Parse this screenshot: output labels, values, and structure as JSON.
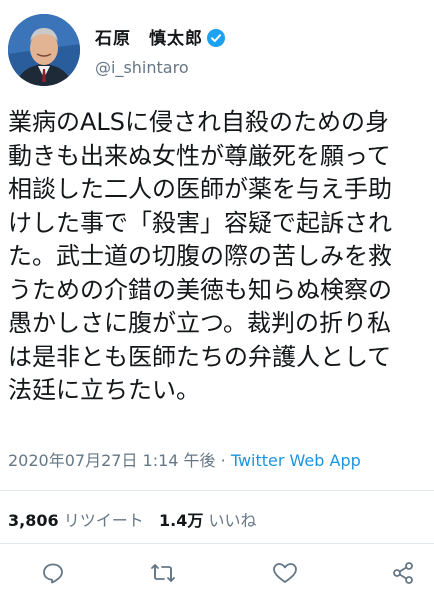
{
  "user": {
    "display_name": "石原　慎太郎",
    "handle": "@i_shintaro",
    "verified": true
  },
  "tweet": {
    "lines": [
      "業病のALSに侵され自殺のための身",
      "動きも出来ぬ女性が尊厳死を願って",
      "相談した二人の医師が薬を与え手助",
      "けした事で「殺害」容疑で起訴され",
      "た。武士道の切腹の際の苦しみを救",
      "うための介錯の美徳も知らぬ検察の",
      "愚かしさに腹が立つ。裁判の折り私",
      "は是非とも医師たちの弁護人として",
      "法廷に立ちたい。"
    ],
    "timestamp": "2020年07月27日 1:14 午後",
    "separator": " · ",
    "source": "Twitter Web App"
  },
  "stats": {
    "retweets_count": "3,806",
    "retweets_label": "リツイート",
    "likes_count": "1.4万",
    "likes_label": "いいね"
  },
  "actions": [
    "reply-icon",
    "retweet-icon",
    "like-icon",
    "share-icon"
  ],
  "colors": {
    "text": "#14171a",
    "secondary": "#657786",
    "link": "#1b95e0",
    "verified": "#1da1f2",
    "divider": "#e1e8ed"
  }
}
